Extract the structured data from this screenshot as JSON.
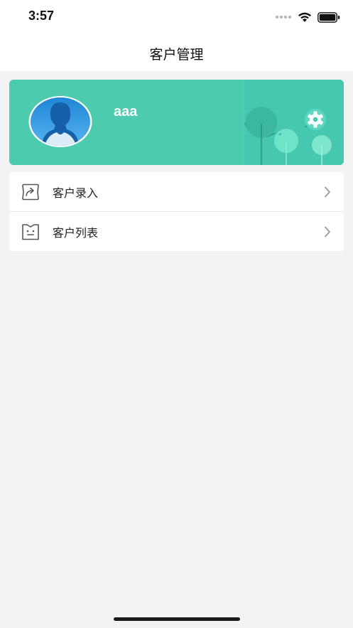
{
  "status_bar": {
    "time": "3:57",
    "icons": [
      "cellular-dots-icon",
      "wifi-icon",
      "battery-icon"
    ]
  },
  "nav": {
    "title": "客户管理"
  },
  "profile": {
    "username": "aaa",
    "avatar_icon": "user-avatar-icon",
    "settings_icon": "gear-icon",
    "colors": {
      "card_bg": "#4dcbae",
      "panel_bg": "#45c7b0",
      "text": "#ffffff"
    }
  },
  "menu": {
    "items": [
      {
        "label": "客户录入",
        "icon": "share-forward-icon",
        "chevron_icon": "chevron-right-icon"
      },
      {
        "label": "客户列表",
        "icon": "list-face-icon",
        "chevron_icon": "chevron-right-icon"
      }
    ]
  }
}
